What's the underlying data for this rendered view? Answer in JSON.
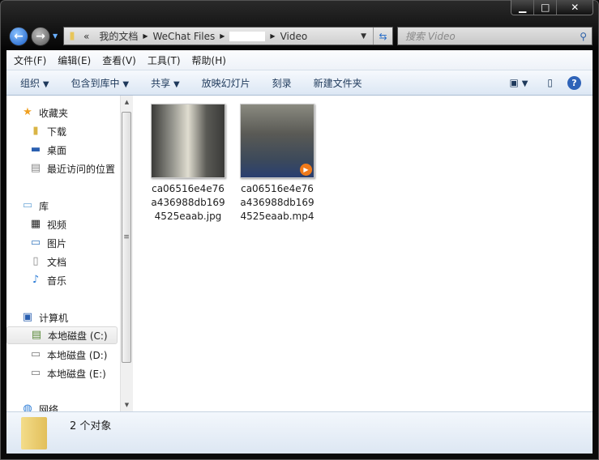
{
  "window": {
    "controls": [
      "minimize",
      "maximize",
      "close"
    ]
  },
  "address": {
    "overflow": "«",
    "segments": [
      "我的文档",
      "WeChat Files",
      "",
      "Video"
    ]
  },
  "search": {
    "placeholder": "搜索 Video"
  },
  "menu": [
    "文件(F)",
    "编辑(E)",
    "查看(V)",
    "工具(T)",
    "帮助(H)"
  ],
  "commands": [
    {
      "label": "组织",
      "dropdown": true
    },
    {
      "label": "包含到库中",
      "dropdown": true
    },
    {
      "label": "共享",
      "dropdown": true
    },
    {
      "label": "放映幻灯片"
    },
    {
      "label": "刻录"
    },
    {
      "label": "新建文件夹"
    }
  ],
  "nav": {
    "favorites": {
      "label": "收藏夹",
      "items": [
        "下载",
        "桌面",
        "最近访问的位置"
      ]
    },
    "libraries": {
      "label": "库",
      "items": [
        "视频",
        "图片",
        "文档",
        "音乐"
      ]
    },
    "computer": {
      "label": "计算机",
      "items": [
        "本地磁盘 (C:)",
        "本地磁盘 (D:)",
        "本地磁盘 (E:)"
      ],
      "selected": 0
    },
    "network": {
      "label": "网络"
    }
  },
  "files": [
    {
      "name": "ca06516e4e76a436988db1694525eaab.jpg",
      "type": "image"
    },
    {
      "name": "ca06516e4e76a436988db1694525eaab.mp4",
      "type": "video"
    }
  ],
  "status": {
    "count": "2 个对象"
  }
}
